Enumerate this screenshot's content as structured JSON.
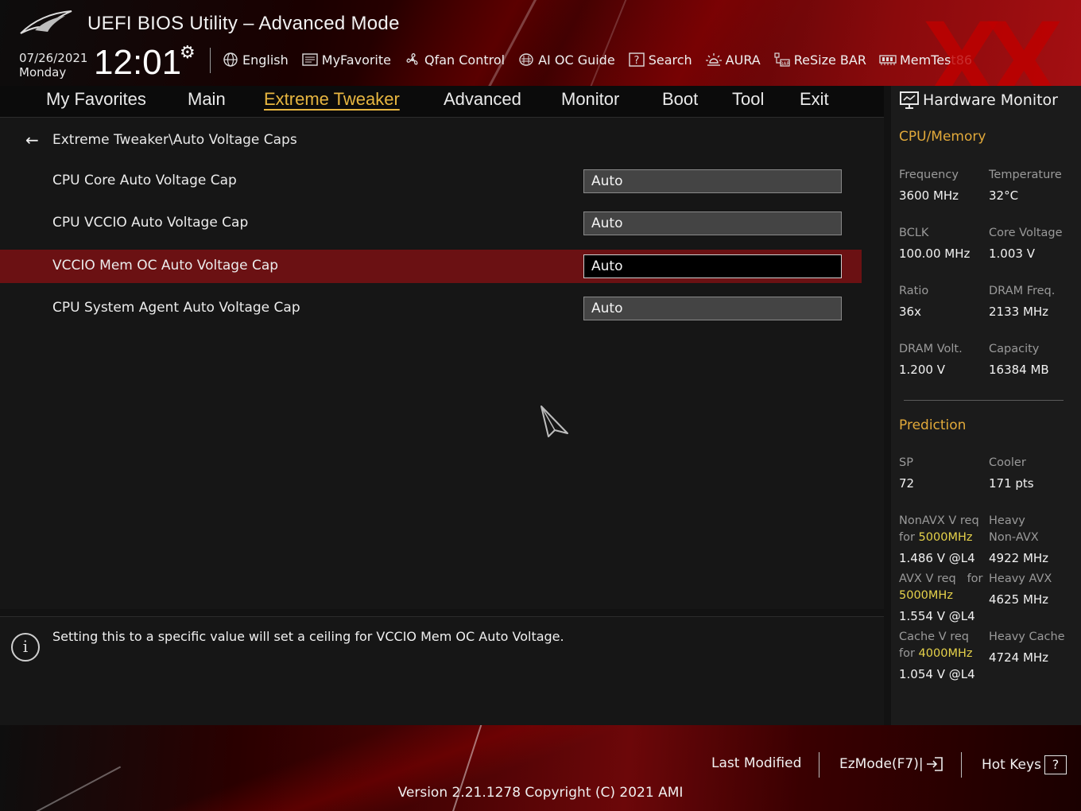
{
  "header": {
    "title": "UEFI BIOS Utility – Advanced Mode",
    "date": "07/26/2021",
    "day": "Monday",
    "time": "12:01",
    "xx_logo": "XX",
    "toolbar": [
      {
        "label": "English",
        "icon": "globe-icon"
      },
      {
        "label": "MyFavorite",
        "icon": "favorite-list-icon"
      },
      {
        "label": "Qfan Control",
        "icon": "fan-icon"
      },
      {
        "label": "AI OC Guide",
        "icon": "ai-chip-icon"
      },
      {
        "label": "Search",
        "icon": "help-search-icon"
      },
      {
        "label": "AURA",
        "icon": "aura-light-icon"
      },
      {
        "label": "ReSize BAR",
        "icon": "resize-bar-icon"
      },
      {
        "label": "MemTest86",
        "icon": "memory-icon"
      }
    ]
  },
  "tabs": [
    {
      "label": "My Favorites"
    },
    {
      "label": "Main"
    },
    {
      "label": "Extreme Tweaker"
    },
    {
      "label": "Advanced"
    },
    {
      "label": "Monitor"
    },
    {
      "label": "Boot"
    },
    {
      "label": "Tool"
    },
    {
      "label": "Exit"
    }
  ],
  "active_tab": "Extreme Tweaker",
  "breadcrumb": "Extreme Tweaker\\Auto Voltage Caps",
  "settings": [
    {
      "label": "CPU Core Auto Voltage Cap",
      "value": "Auto"
    },
    {
      "label": "CPU VCCIO Auto Voltage Cap",
      "value": "Auto"
    },
    {
      "label": "VCCIO Mem OC Auto Voltage Cap",
      "value": "Auto"
    },
    {
      "label": "CPU System Agent Auto Voltage Cap",
      "value": "Auto"
    }
  ],
  "selected_setting": "VCCIO Mem OC Auto Voltage Cap",
  "help_text": "Setting this to a specific value will set a ceiling for VCCIO Mem OC Auto Voltage.",
  "hardware_monitor": {
    "title": "Hardware Monitor",
    "cpu_memory": {
      "heading": "CPU/Memory",
      "frequency": {
        "label": "Frequency",
        "value": "3600 MHz"
      },
      "temperature": {
        "label": "Temperature",
        "value": "32°C"
      },
      "bclk": {
        "label": "BCLK",
        "value": "100.00 MHz"
      },
      "core_voltage": {
        "label": "Core Voltage",
        "value": "1.003 V"
      },
      "ratio": {
        "label": "Ratio",
        "value": "36x"
      },
      "dram_freq": {
        "label": "DRAM Freq.",
        "value": "2133 MHz"
      },
      "dram_volt": {
        "label": "DRAM Volt.",
        "value": "1.200 V"
      },
      "capacity": {
        "label": "Capacity",
        "value": "16384 MB"
      }
    },
    "prediction": {
      "heading": "Prediction",
      "sp": {
        "label": "SP",
        "value": "72"
      },
      "cooler": {
        "label": "Cooler",
        "value": "171 pts"
      },
      "nonavx_req": {
        "label": "NonAVX V req",
        "for": "for",
        "freq": "5000MHz",
        "value": "1.486 V @L4"
      },
      "heavy_nonavx": {
        "label1": "Heavy",
        "label2": "Non-AVX",
        "value": "4922 MHz"
      },
      "avx_req": {
        "label": "AVX V req",
        "for": "for",
        "freq": "5000MHz",
        "value": "1.554 V @L4"
      },
      "heavy_avx": {
        "label": "Heavy AVX",
        "value": "4625 MHz"
      },
      "cache_req": {
        "label": "Cache V req",
        "for": "for",
        "freq": "4000MHz",
        "value": "1.054 V @L4"
      },
      "heavy_cache": {
        "label": "Heavy Cache",
        "value": "4724 MHz"
      }
    }
  },
  "footer": {
    "last_modified": "Last Modified",
    "ezmode": "EzMode(F7)|",
    "hotkeys": "Hot Keys",
    "hotkeys_glyph": "?",
    "version": "Version 2.21.1278 Copyright (C) 2021 AMI"
  }
}
